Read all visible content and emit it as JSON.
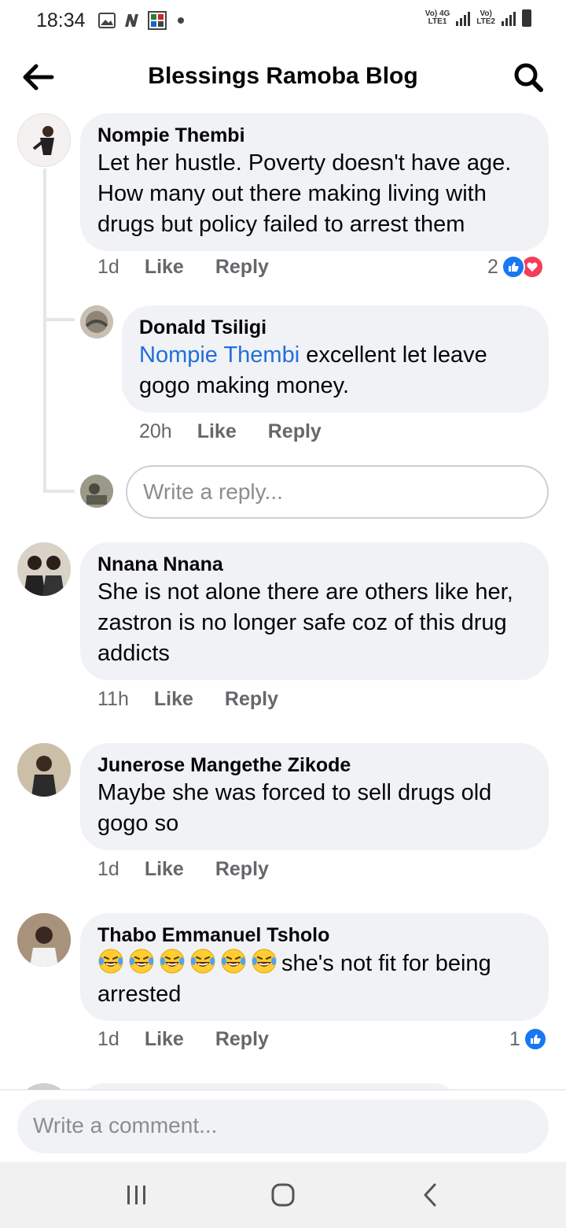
{
  "status_bar": {
    "time": "18:34",
    "network_1": "Vo) 4G",
    "network_1_sub": "LTE1",
    "network_2": "Vo)",
    "network_2_sub": "LTE2"
  },
  "header": {
    "title": "Blessings Ramoba Blog"
  },
  "comments": [
    {
      "name": "Nompie Thembi",
      "text": "Let her hustle. Poverty doesn't have age. How many out there making living with drugs but policy failed to arrest them",
      "time": "1d",
      "like": "Like",
      "reply": "Reply",
      "reaction_count": "2",
      "replies": [
        {
          "name": "Donald Tsiligi",
          "mention": "Nompie Thembi",
          "text": " excellent let leave gogo making money.",
          "time": "20h",
          "like": "Like",
          "reply": "Reply"
        }
      ],
      "reply_placeholder": "Write a reply..."
    },
    {
      "name": "Nnana Nnana",
      "text": "She is not alone there are others like her, zastron is no longer safe coz of this drug addicts",
      "time": "11h",
      "like": "Like",
      "reply": "Reply"
    },
    {
      "name": "Junerose Mangethe Zikode",
      "text": "Maybe she was forced to sell drugs old gogo so",
      "time": "1d",
      "like": "Like",
      "reply": "Reply"
    },
    {
      "name": "Thabo Emmanuel Tsholo",
      "text": "she's not fit for being arrested",
      "emoji_count": 6,
      "time": "1d",
      "like": "Like",
      "reply": "Reply",
      "reaction_count": "1"
    }
  ],
  "composer": {
    "placeholder": "Write a comment..."
  },
  "colors": {
    "bubble": "#f0f2f5",
    "link": "#216fdb",
    "like_blue": "#1877f2",
    "love_red": "#f33e58",
    "meta_gray": "#65676b"
  }
}
